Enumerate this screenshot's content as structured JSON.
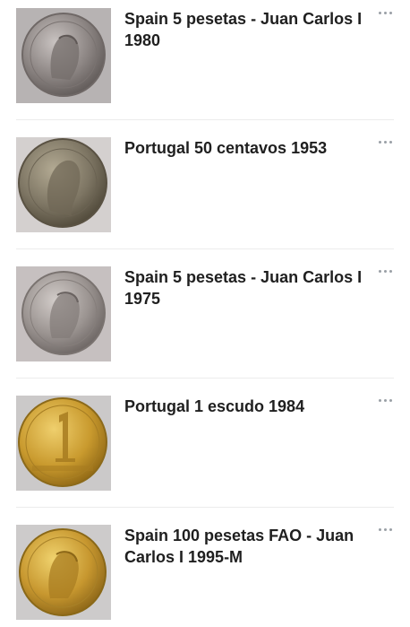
{
  "items": [
    {
      "title": "Spain 5 pesetas - Juan Carlos I 1980",
      "coin": "silver",
      "bg": "#b7b3b3",
      "image": "coin-portrait"
    },
    {
      "title": "Portugal 50 centavos 1953",
      "coin": "copper-nickel",
      "bg": "#d4d0cf",
      "image": "coin-liberty-head"
    },
    {
      "title": "Spain 5 pesetas - Juan Carlos I 1975",
      "coin": "silver",
      "bg": "#c6c0c0",
      "image": "coin-portrait"
    },
    {
      "title": "Portugal 1 escudo 1984",
      "coin": "brass",
      "bg": "#cbc9c9",
      "image": "coin-numeral-1"
    },
    {
      "title": "Spain 100 pesetas  FAO - Juan Carlos I 1995-M",
      "coin": "gold",
      "bg": "#cdcbcb",
      "image": "coin-portrait"
    }
  ],
  "more_icon": "more-horizontal-icon"
}
